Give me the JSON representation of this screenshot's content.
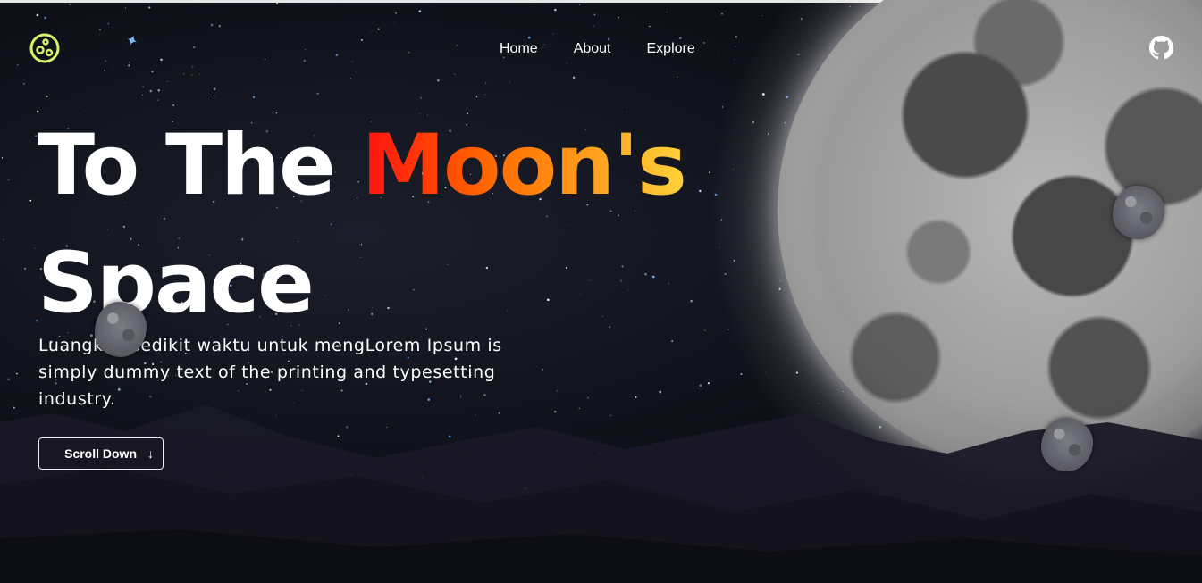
{
  "nav": {
    "items": [
      "Home",
      "About",
      "Explore"
    ]
  },
  "hero": {
    "title_part1": "To The ",
    "title_accent": "Moon's",
    "title_part2": "Space",
    "description": "Luangkan sedikit waktu untuk mengLorem Ipsum is simply dummy text of the printing and typesetting industry.",
    "button_label": "Scroll Down"
  },
  "colors": {
    "accent_gradient_start": "#ff1010",
    "accent_gradient_mid": "#ff6a00",
    "accent_gradient_end": "#ffd23a",
    "logo": "#d7f26a"
  },
  "icons": {
    "logo": "planet-logo-icon",
    "github": "github-icon",
    "button": "arrow-down-icon",
    "sparkle": "star-sparkle-icon"
  }
}
